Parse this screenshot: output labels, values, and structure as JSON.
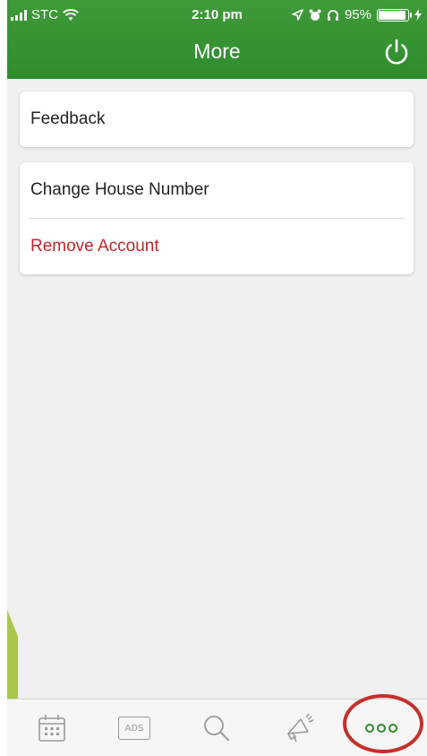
{
  "status_bar": {
    "carrier": "STC",
    "time": "2:10 pm",
    "battery": "95%",
    "battery_level": 0.95
  },
  "header": {
    "title": "More",
    "icon": "power-icon"
  },
  "menu": {
    "group1": [
      {
        "label": "Feedback"
      }
    ],
    "group2": [
      {
        "label": "Change House Number"
      },
      {
        "label": "Remove Account"
      }
    ]
  },
  "tabbar": {
    "items": [
      {
        "icon": "calendar-icon"
      },
      {
        "icon": "ads-icon",
        "label": "ADS"
      },
      {
        "icon": "search-icon"
      },
      {
        "icon": "megaphone-icon"
      },
      {
        "icon": "more-icon"
      }
    ]
  },
  "colors": {
    "header_green": "#2f8c2d",
    "danger_red": "#c0262d",
    "highlight_red": "#c4302b"
  }
}
